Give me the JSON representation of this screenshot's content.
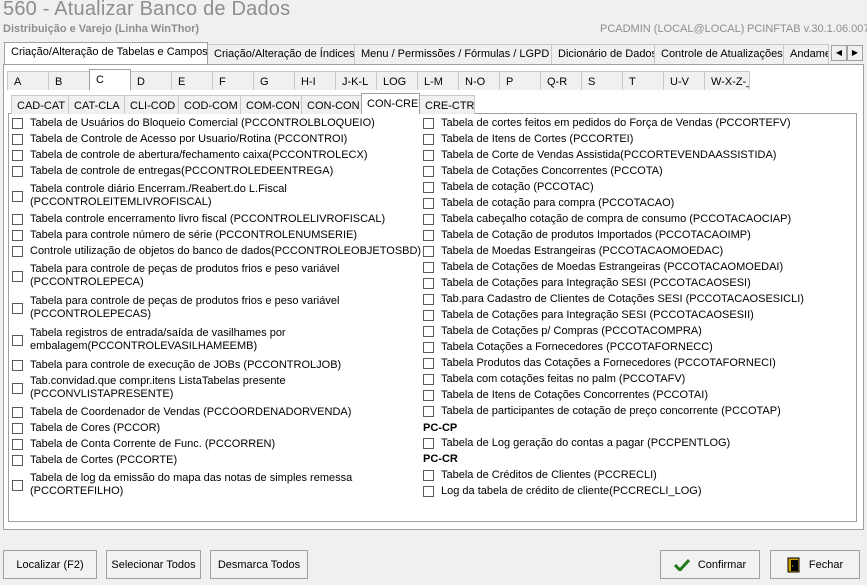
{
  "window": {
    "title": "560 - Atualizar Banco de Dados",
    "subtitle": "Distribuição e Varejo (Linha WinThor)",
    "user": "PCADMIN (LOCAL@LOCAL)",
    "version": "PCINFTAB  v.30.1.06.007"
  },
  "top_tabs": [
    "Criação/Alteração de Tabelas e Campos",
    "Criação/Alteração de Índices",
    "Menu / Permissões / Fórmulas / LGPD",
    "Dicionário de Dados",
    "Controle de Atualizações",
    "Andame"
  ],
  "letter_tabs": [
    "A",
    "B",
    "C",
    "D",
    "E",
    "F",
    "G",
    "H-I",
    "J-K-L",
    "LOG",
    "L-M",
    "N-O",
    "P",
    "Q-R",
    "S",
    "T",
    "U-V",
    "W-X-Z-_"
  ],
  "sub_tabs": [
    "CAD-CAT",
    "CAT-CLA",
    "CLI-COD",
    "COD-COM",
    "COM-CON",
    "CON-CON",
    "CON-CRE",
    "CRE-CTR"
  ],
  "col1": [
    "Tabela de Usuários do Bloqueio Comercial (PCCONTROLBLOQUEIO)",
    "Tabela de Controle de Acesso por Usuario/Rotina (PCCONTROI)",
    "Tabela de controle de abertura/fechamento caixa(PCCONTROLECX)",
    "Tabela de controle de entregas(PCCONTROLEDEENTREGA)",
    "Tabela controle diário Encerram./Reabert.do L.Fiscal (PCCONTROLEITEMLIVROFISCAL)",
    "Tabela controle encerramento livro fiscal (PCCONTROLELIVROFISCAL)",
    "Tabela para controle número de série (PCCONTROLENUMSERIE)",
    "Controle utilização de objetos do banco de dados(PCCONTROLEOBJETOSBD)",
    "Tabela para controle de peças de produtos frios e peso variável (PCCONTROLEPECA)",
    "Tabela para controle de peças de produtos frios e peso variável (PCCONTROLEPECAS)",
    "Tabela registros de entrada/saída de vasilhames por embalagem(PCCONTROLEVASILHAMEEMB)",
    "Tabela para controle de execução de JOBs (PCCONTROLJOB)",
    "Tab.convidad.que compr.itens ListaTabelas presente (PCCONVLISTAPRESENTE)",
    "Tabela de Coordenador de Vendas (PCCOORDENADORVENDA)",
    "Tabela de Cores (PCCOR)",
    "Tabela de Conta Corrente de Func. (PCCORREN)",
    "Tabela de Cortes (PCCORTE)",
    "Tabela de log da emissão do mapa das notas de simples remessa (PCCORTEFILHO)"
  ],
  "col2": [
    "Tabela de cortes feitos em pedidos do Força de Vendas (PCCORTEFV)",
    "Tabela de Itens de Cortes (PCCORTEI)",
    "Tabela de Corte de Vendas Assistida(PCCORTEVENDAASSISTIDA)",
    "Tabela de Cotações Concorrentes (PCCOTA)",
    "Tabela de cotação (PCCOTAC)",
    "Tabela de cotação para compra  (PCCOTACAO)",
    "Tabela cabeçalho cotação de compra de consumo (PCCOTACAOCIAP)",
    "Tabela de Cotação de produtos Importados (PCCOTACAOIMP)",
    "Tabela de Moedas Estrangeiras (PCCOTACAOMOEDAC)",
    "Tabela de Cotações de Moedas Estrangeiras (PCCOTACAOMOEDAI)",
    "Tabela de Cotações para Integração SESI (PCCOTACAOSESI)",
    "Tab.para Cadastro de Clientes de Cotações SESI (PCCOTACAOSESICLI)",
    "Tabela de Cotações para Integração SESI (PCCOTACAOSESII)",
    "Tabela de Cotações p/ Compras (PCCOTACOMPRA)",
    "Tabela Cotações a Fornecedores (PCCOTAFORNECC)",
    "Tabela Produtos das Cotações a Fornecedores (PCCOTAFORNECI)",
    "Tabela com cotações feitas no palm (PCCOTAFV)",
    "Tabela de Itens de Cotações Concorrentes (PCCOTAI)",
    "Tabela de participantes de cotação de preço concorrente (PCCOTAP)"
  ],
  "groups": [
    {
      "header": "PC-CP",
      "items": [
        "Tabela de Log geração do contas a pagar (PCCPENTLOG)"
      ]
    },
    {
      "header": "PC-CR",
      "items": [
        "Tabela de Créditos de Clientes (PCCRECLI)",
        "Log da tabela de crédito de cliente(PCCRECLI_LOG)"
      ]
    }
  ],
  "buttons": {
    "localizar": "Localizar (F2)",
    "selecionar": "Selecionar Todos",
    "desmarca": "Desmarca Todos",
    "confirmar": "Confirmar",
    "fechar": "Fechar"
  },
  "colors": {
    "title_gray": "#8e8e8e",
    "confirm_icon": "#1f7a1f",
    "close_icon": "#c8a000"
  },
  "icons": [
    "chevron-left-icon",
    "chevron-right-icon",
    "checkmark-icon",
    "door-exit-icon"
  ]
}
